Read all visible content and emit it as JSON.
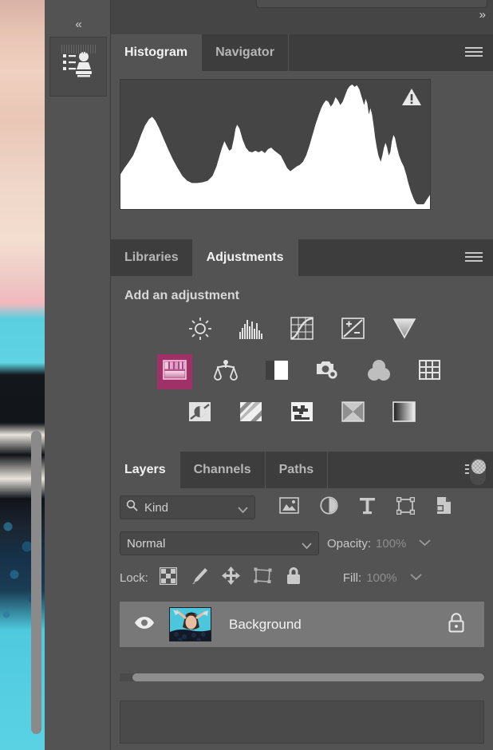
{
  "app": {
    "name": "Adobe Photoshop",
    "theme_bg": "#535353",
    "panel_header_bg": "#3d3d3d"
  },
  "dock": {
    "collapse_label": "«",
    "tile_icon": "clone-stamp-actions-icon"
  },
  "topbar": {
    "collapse_label": "»"
  },
  "histogram_panel": {
    "tabs": [
      {
        "label": "Histogram",
        "active": true
      },
      {
        "label": "Navigator",
        "active": false
      }
    ],
    "menu_icon": "panel-menu-icon",
    "warning_icon": "cached-data-warning-icon"
  },
  "adjustments_panel": {
    "tabs": [
      {
        "label": "Libraries",
        "active": false
      },
      {
        "label": "Adjustments",
        "active": true
      }
    ],
    "menu_icon": "panel-menu-icon",
    "heading": "Add an adjustment",
    "selected_highlight_color": "#a03068",
    "annotation_arrow_color": "#e8246e",
    "rows": [
      [
        {
          "name": "brightness-contrast",
          "icon": "brightness-contrast-icon",
          "selected": false
        },
        {
          "name": "levels",
          "icon": "levels-icon",
          "selected": false
        },
        {
          "name": "curves",
          "icon": "curves-icon",
          "selected": false
        },
        {
          "name": "exposure",
          "icon": "exposure-icon",
          "selected": false
        },
        {
          "name": "vibrance",
          "icon": "vibrance-icon",
          "selected": false
        }
      ],
      [
        {
          "name": "hue-saturation",
          "icon": "hue-saturation-icon",
          "selected": true
        },
        {
          "name": "color-balance",
          "icon": "color-balance-icon",
          "selected": false
        },
        {
          "name": "black-and-white",
          "icon": "black-and-white-icon",
          "selected": false
        },
        {
          "name": "photo-filter",
          "icon": "photo-filter-icon",
          "selected": false
        },
        {
          "name": "channel-mixer",
          "icon": "channel-mixer-icon",
          "selected": false
        },
        {
          "name": "color-lookup",
          "icon": "color-lookup-icon",
          "selected": false
        }
      ],
      [
        {
          "name": "invert",
          "icon": "invert-icon",
          "selected": false
        },
        {
          "name": "posterize",
          "icon": "posterize-icon",
          "selected": false
        },
        {
          "name": "threshold",
          "icon": "threshold-icon",
          "selected": false
        },
        {
          "name": "selective-color",
          "icon": "selective-color-icon",
          "selected": false
        },
        {
          "name": "gradient-map",
          "icon": "gradient-map-icon",
          "selected": false
        }
      ]
    ]
  },
  "layers_panel": {
    "tabs": [
      {
        "label": "Layers",
        "active": true
      },
      {
        "label": "Channels",
        "active": false
      },
      {
        "label": "Paths",
        "active": false
      }
    ],
    "menu_icon": "panel-menu-icon",
    "filter": {
      "search_icon": "search-icon",
      "kind_value": "Kind",
      "caret_icon": "chevron-down-icon",
      "type_filters": [
        {
          "name": "filter-pixel",
          "icon": "image-icon"
        },
        {
          "name": "filter-adjustment",
          "icon": "half-circle-icon"
        },
        {
          "name": "filter-type",
          "icon": "text-t-icon"
        },
        {
          "name": "filter-shape",
          "icon": "shape-bounds-icon"
        },
        {
          "name": "filter-smart-object",
          "icon": "smart-object-icon"
        }
      ],
      "toggle_icon": "filter-enable-toggle"
    },
    "blend": {
      "mode_value": "Normal",
      "caret_icon": "chevron-down-icon",
      "opacity_label": "Opacity:",
      "opacity_value": "100%"
    },
    "lock": {
      "label": "Lock:",
      "icons": [
        {
          "name": "lock-transparent-pixels",
          "icon": "checkerboard-icon"
        },
        {
          "name": "lock-image-pixels",
          "icon": "brush-icon"
        },
        {
          "name": "lock-position",
          "icon": "move-arrows-icon"
        },
        {
          "name": "lock-artboard-nesting",
          "icon": "artboard-icon"
        },
        {
          "name": "lock-all",
          "icon": "padlock-icon"
        }
      ],
      "fill_label": "Fill:",
      "fill_value": "100%"
    },
    "layers": [
      {
        "name": "Background",
        "visible": true,
        "locked": true,
        "eye_icon": "eye-visible-icon",
        "lock_icon": "padlock-icon",
        "thumbnail": "photo-thumbnail"
      }
    ]
  }
}
